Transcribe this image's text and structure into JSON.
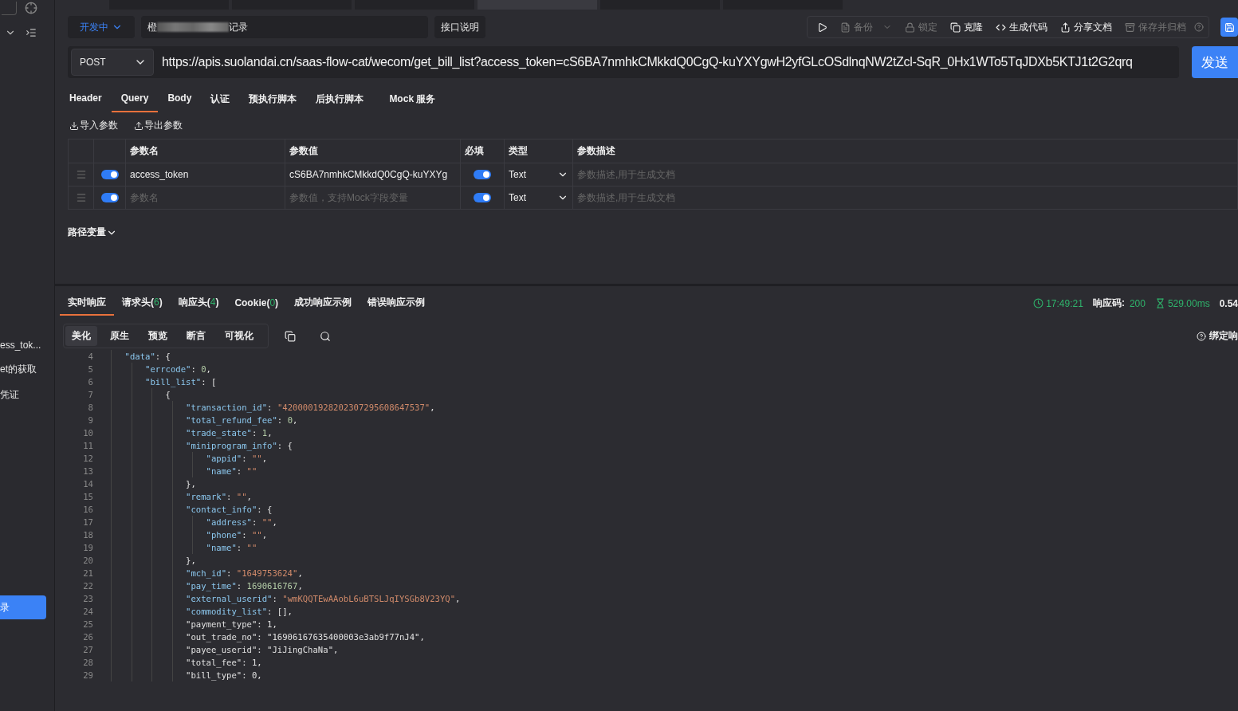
{
  "request_tabs": [
    {
      "selected": false
    },
    {
      "selected": false
    },
    {
      "selected": false
    },
    {
      "selected": true
    },
    {
      "selected": false
    },
    {
      "selected": false
    }
  ],
  "sidebar": {
    "items": [
      {
        "label": "ess_tok..."
      },
      {
        "label": "et的获取"
      },
      {
        "label": "凭证"
      }
    ],
    "action_button": "录"
  },
  "header": {
    "env": "开发中",
    "title_prefix": "橙",
    "title_suffix": "记录",
    "doc_button": "接口说明",
    "tools": [
      {
        "kind": "play"
      },
      {
        "kind": "backup",
        "label": "备份",
        "disabled": true
      },
      {
        "kind": "lock",
        "label": "锁定",
        "disabled": true
      },
      {
        "kind": "clone",
        "label": "克隆",
        "disabled": false
      },
      {
        "kind": "code",
        "label": "生成代码",
        "disabled": false
      },
      {
        "kind": "share",
        "label": "分享文档",
        "disabled": false
      },
      {
        "kind": "archive",
        "label": "保存并归档",
        "disabled": true
      }
    ]
  },
  "request": {
    "method": "POST",
    "url": "https://apis.suolandai.cn/saas-flow-cat/wecom/get_bill_list?access_token=cS6BA7nmhkCMkkdQ0CgQ-kuYXYgwH2yfGLcOSdlnqNW2tZcl-SqR_0Hx1WTo5TqJDXb5KTJ1t2G2qrq",
    "send": "发送"
  },
  "tabs": [
    {
      "label": "Header",
      "selected": false
    },
    {
      "label": "Query",
      "selected": true
    },
    {
      "label": "Body",
      "selected": false
    },
    {
      "label": "认证",
      "selected": false
    },
    {
      "label": "预执行脚本",
      "selected": false
    },
    {
      "label": "后执行脚本",
      "selected": false
    },
    {
      "label": "Mock 服务",
      "selected": false
    }
  ],
  "param_actions": [
    {
      "kind": "import",
      "label": "导入参数"
    },
    {
      "kind": "export",
      "label": "导出参数"
    }
  ],
  "params": {
    "columns": [
      "参数名",
      "参数值",
      "必填",
      "类型",
      "参数描述"
    ],
    "rows": [
      {
        "enabled": true,
        "name": "access_token",
        "value": "cS6BA7nmhkCMkkdQ0CgQ-kuYXYg",
        "required": true,
        "type": "Text",
        "description_placeholder": "参数描述,用于生成文档"
      },
      {
        "enabled": true,
        "name_placeholder": "参数名",
        "value_placeholder": "参数值，支持Mock字段变量",
        "required": true,
        "type": "Text",
        "description_placeholder": "参数描述,用于生成文档"
      }
    ]
  },
  "path_vars": "路径变量",
  "response": {
    "tabs": [
      {
        "label": "实时响应",
        "selected": true
      },
      {
        "label": "请求头(",
        "count": "6",
        "close": ")",
        "selected": false
      },
      {
        "label": "响应头(",
        "count": "4",
        "close": ")",
        "selected": false
      },
      {
        "label": "Cookie(",
        "count": "0",
        "close": ")",
        "selected": false
      },
      {
        "label": "成功响应示例",
        "selected": false
      },
      {
        "label": "错误响应示例",
        "selected": false
      }
    ],
    "time": "17:49:21",
    "code_label": "响应码:",
    "code": "200",
    "duration": "529.00ms",
    "size": "0.54",
    "views": [
      {
        "label": "美化",
        "selected": true
      },
      {
        "label": "原生",
        "selected": false
      },
      {
        "label": "预览",
        "selected": false
      },
      {
        "label": "断言",
        "selected": false
      },
      {
        "label": "可视化",
        "selected": false
      }
    ],
    "bind": "绑定响",
    "lines": [
      {
        "no": "4",
        "parts": [
          {
            "kind": "key",
            "text": "    \"data\""
          },
          {
            "kind": "punct",
            "text": ": {"
          }
        ]
      },
      {
        "no": "5",
        "parts": [
          {
            "kind": "key",
            "text": "        \"errcode\""
          },
          {
            "kind": "punct",
            "text": ": "
          },
          {
            "kind": "number",
            "text": "0"
          },
          {
            "kind": "punct",
            "text": ","
          }
        ]
      },
      {
        "no": "6",
        "parts": [
          {
            "kind": "key",
            "text": "        \"bill_list\""
          },
          {
            "kind": "punct",
            "text": ": ["
          }
        ]
      },
      {
        "no": "7",
        "parts": [
          {
            "kind": "punct",
            "text": "            {"
          }
        ]
      },
      {
        "no": "8",
        "parts": [
          {
            "kind": "key",
            "text": "                \"transaction_id\""
          },
          {
            "kind": "punct",
            "text": ": "
          },
          {
            "kind": "string",
            "text": "\"4200001928202307295608647537\""
          },
          {
            "kind": "punct",
            "text": ","
          }
        ]
      },
      {
        "no": "9",
        "parts": [
          {
            "kind": "key",
            "text": "                \"total_refund_fee\""
          },
          {
            "kind": "punct",
            "text": ": "
          },
          {
            "kind": "number",
            "text": "0"
          },
          {
            "kind": "punct",
            "text": ","
          }
        ]
      },
      {
        "no": "10",
        "parts": [
          {
            "kind": "key",
            "text": "                \"trade_state\""
          },
          {
            "kind": "punct",
            "text": ": "
          },
          {
            "kind": "number",
            "text": "1"
          },
          {
            "kind": "punct",
            "text": ","
          }
        ]
      },
      {
        "no": "11",
        "parts": [
          {
            "kind": "key",
            "text": "                \"miniprogram_info\""
          },
          {
            "kind": "punct",
            "text": ": {"
          }
        ]
      },
      {
        "no": "12",
        "parts": [
          {
            "kind": "key",
            "text": "                    \"appid\""
          },
          {
            "kind": "punct",
            "text": ": "
          },
          {
            "kind": "string",
            "text": "\"\""
          },
          {
            "kind": "punct",
            "text": ","
          }
        ]
      },
      {
        "no": "13",
        "parts": [
          {
            "kind": "key",
            "text": "                    \"name\""
          },
          {
            "kind": "punct",
            "text": ": "
          },
          {
            "kind": "string",
            "text": "\"\""
          }
        ]
      },
      {
        "no": "14",
        "parts": [
          {
            "kind": "punct",
            "text": "                },"
          }
        ]
      },
      {
        "no": "15",
        "parts": [
          {
            "kind": "key",
            "text": "                \"remark\""
          },
          {
            "kind": "punct",
            "text": ": "
          },
          {
            "kind": "string",
            "text": "\"\""
          },
          {
            "kind": "punct",
            "text": ","
          }
        ]
      },
      {
        "no": "16",
        "parts": [
          {
            "kind": "key",
            "text": "                \"contact_info\""
          },
          {
            "kind": "punct",
            "text": ": {"
          }
        ]
      },
      {
        "no": "17",
        "parts": [
          {
            "kind": "key",
            "text": "                    \"address\""
          },
          {
            "kind": "punct",
            "text": ": "
          },
          {
            "kind": "string",
            "text": "\"\""
          },
          {
            "kind": "punct",
            "text": ","
          }
        ]
      },
      {
        "no": "18",
        "parts": [
          {
            "kind": "key",
            "text": "                    \"phone\""
          },
          {
            "kind": "punct",
            "text": ": "
          },
          {
            "kind": "string",
            "text": "\"\""
          },
          {
            "kind": "punct",
            "text": ","
          }
        ]
      },
      {
        "no": "19",
        "parts": [
          {
            "kind": "key",
            "text": "                    \"name\""
          },
          {
            "kind": "punct",
            "text": ": "
          },
          {
            "kind": "string",
            "text": "\"\""
          }
        ]
      },
      {
        "no": "20",
        "parts": [
          {
            "kind": "punct",
            "text": "                },"
          }
        ]
      },
      {
        "no": "21",
        "parts": [
          {
            "kind": "key",
            "text": "                \"mch_id\""
          },
          {
            "kind": "punct",
            "text": ": "
          },
          {
            "kind": "string",
            "text": "\"1649753624\""
          },
          {
            "kind": "punct",
            "text": ","
          }
        ]
      },
      {
        "no": "22",
        "parts": [
          {
            "kind": "key",
            "text": "                \"pay_time\""
          },
          {
            "kind": "punct",
            "text": ": "
          },
          {
            "kind": "number",
            "text": "1690616767"
          },
          {
            "kind": "punct",
            "text": ","
          }
        ]
      },
      {
        "no": "23",
        "parts": [
          {
            "kind": "key",
            "text": "                \"external_userid\""
          },
          {
            "kind": "punct",
            "text": ": "
          },
          {
            "kind": "string",
            "text": "\"wmKQQTEwAAobL6uBTSLJqIYSGb8V23YQ\""
          },
          {
            "kind": "punct",
            "text": ","
          }
        ]
      },
      {
        "no": "24",
        "parts": [
          {
            "kind": "key",
            "text": "                \"commodity_list\""
          },
          {
            "kind": "punct",
            "text": ": [],"
          }
        ]
      },
      {
        "no": "25",
        "parts": [
          {
            "kind": "plain",
            "text": "                \"payment_type\": 1,"
          }
        ]
      },
      {
        "no": "26",
        "parts": [
          {
            "kind": "plain",
            "text": "                \"out_trade_no\": \"16906167635400003e3ab9f77nJ4\","
          }
        ]
      },
      {
        "no": "27",
        "parts": [
          {
            "kind": "plain",
            "text": "                \"payee_userid\": \"JiJingChaNa\","
          }
        ]
      },
      {
        "no": "28",
        "parts": [
          {
            "kind": "plain",
            "text": "                \"total_fee\": 1,"
          }
        ]
      },
      {
        "no": "29",
        "parts": [
          {
            "kind": "plain",
            "text": "                \"bill_type\": 0,"
          }
        ]
      }
    ]
  }
}
